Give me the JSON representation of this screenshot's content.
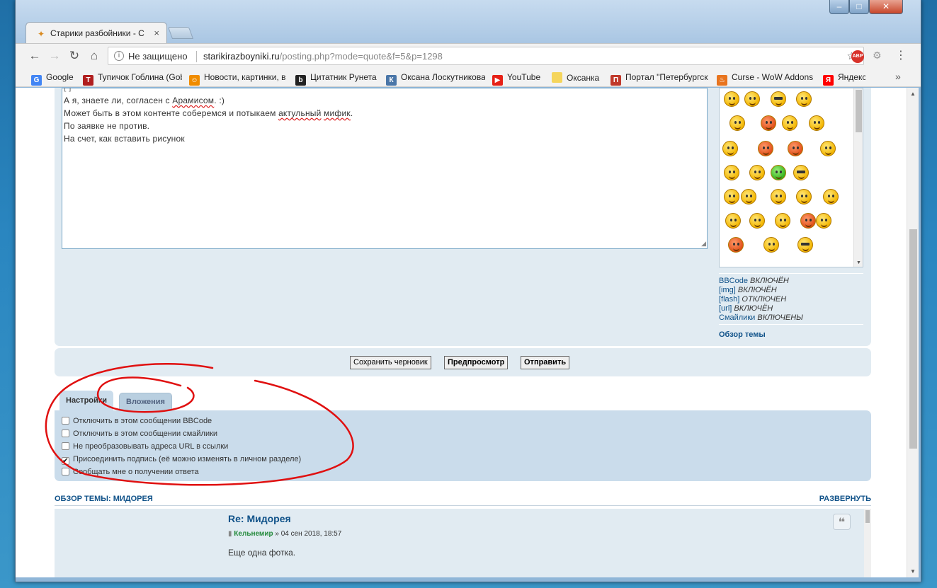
{
  "window": {
    "tab_title": "Старики разбойники - С",
    "tab_close": "×",
    "controls": {
      "minimize": "–",
      "maximize": "□",
      "close": "✕"
    }
  },
  "toolbar": {
    "back": "←",
    "forward": "→",
    "reload": "↻",
    "home": "⌂",
    "security_label": "Не защищено",
    "url_host": "starikirazboyniki.ru",
    "url_path": "/posting.php?mode=quote&f=5&p=1298",
    "star": "☆",
    "abp_label": "ABP",
    "menu": "⋮"
  },
  "bookmarks": {
    "items": [
      {
        "label": "Google",
        "icon": "google-icon",
        "color": "#4285f4",
        "glyph": "G"
      },
      {
        "label": "Тупичок Гоблина (Gob",
        "icon": "goblin-icon",
        "color": "#b01e1e",
        "glyph": "Т"
      },
      {
        "label": "Новости, картинки, в",
        "icon": "smile-icon",
        "color": "#f08c00",
        "glyph": "☺"
      },
      {
        "label": "Цитатник Рунета",
        "icon": "bash-icon",
        "color": "#222222",
        "glyph": "b"
      },
      {
        "label": "Оксана Лоскутникова",
        "icon": "vk-icon",
        "color": "#4a76a8",
        "glyph": "К"
      },
      {
        "label": "YouTube",
        "icon": "youtube-icon",
        "color": "#e62117",
        "glyph": "▶"
      },
      {
        "label": "Оксанка",
        "icon": "folder-icon",
        "color": "#f5d55c",
        "glyph": ""
      },
      {
        "label": "Портал \"Петербургск",
        "icon": "spb-icon",
        "color": "#c0392b",
        "glyph": "П"
      },
      {
        "label": "Curse - WoW Addons",
        "icon": "curse-icon",
        "color": "#e8741e",
        "glyph": "♨"
      },
      {
        "label": "Яндекс",
        "icon": "yandex-icon",
        "color": "#ff0000",
        "glyph": "Я"
      }
    ],
    "more": "»"
  },
  "editor": {
    "lines": [
      {
        "parts": [
          {
            "t": "А я, знаете ли, согласен с "
          },
          {
            "t": "Арамисом",
            "spell": true
          },
          {
            "t": ". :)"
          }
        ]
      },
      {
        "parts": [
          {
            "t": "Может быть в этом контенте соберемся и потыкаем "
          },
          {
            "t": "актульный",
            "spell": true
          },
          {
            "t": " "
          },
          {
            "t": "мифик",
            "spell": true
          },
          {
            "t": "."
          }
        ]
      },
      {
        "parts": [
          {
            "t": "По заявке не против."
          }
        ]
      },
      {
        "parts": [
          {
            "t": "На счет, как вставить рисунок"
          }
        ]
      }
    ]
  },
  "status": {
    "bbcode": {
      "name": "BBCode",
      "state": "ВКЛЮЧЁН"
    },
    "img": {
      "name": "[img]",
      "state": "ВКЛЮЧЁН"
    },
    "flash": {
      "name": "[flash]",
      "state": "ОТКЛЮЧЕН"
    },
    "url": {
      "name": "[url]",
      "state": "ВКЛЮЧЁН"
    },
    "smilies": {
      "name": "Смайлики",
      "state": "ВКЛЮЧЕНЫ"
    },
    "topic_overview": "Обзор темы"
  },
  "buttons": {
    "save_draft": "Сохранить черновик",
    "preview": "Предпросмотр",
    "submit": "Отправить"
  },
  "panel_tabs": {
    "settings": "Настройки",
    "attachments": "Вложения"
  },
  "options": [
    {
      "label": "Отключить в этом сообщении BBCode",
      "checked": false
    },
    {
      "label": "Отключить в этом сообщении смайлики",
      "checked": false
    },
    {
      "label": "Не преобразовывать адреса URL в ссылки",
      "checked": false
    },
    {
      "label": "Присоединить подпись (её можно изменять в личном разделе)",
      "checked": true
    },
    {
      "label": "Сообщать мне о получении ответа",
      "checked": false
    }
  ],
  "review": {
    "header": "ОБЗОР ТЕМЫ: МИДОРЕЯ",
    "expand": "РАЗВЕРНУТЬ",
    "post_title": "Re: Мидорея",
    "author": "Кельнемир",
    "date": "» 04 сен 2018, 18:57",
    "text": "Еще одна фотка.",
    "quote_icon": "❝"
  },
  "colors": {
    "link": "#105289",
    "panel": "#e1ebf2",
    "options_panel": "#cadceb",
    "annotation": "#e01010"
  }
}
